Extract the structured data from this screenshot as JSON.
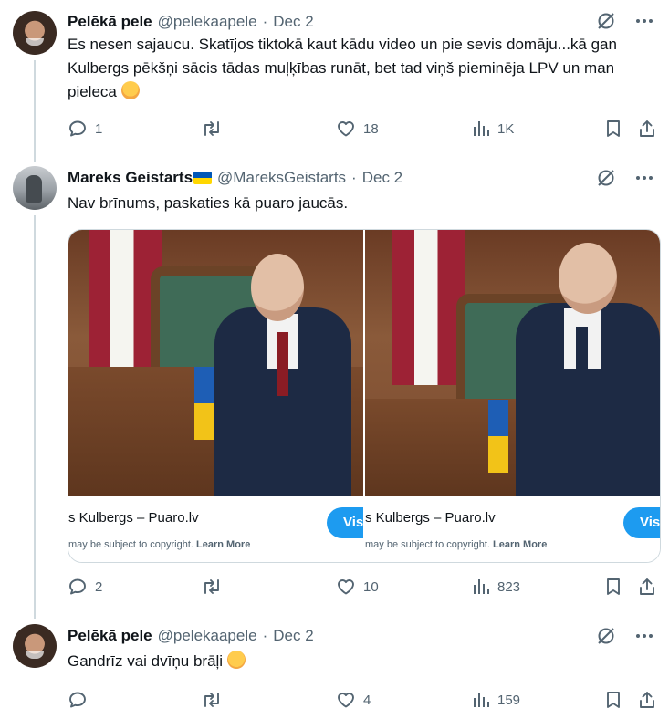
{
  "tweets": [
    {
      "name": "Pelēkā pele",
      "handle": "@pelekaapele",
      "sep": "·",
      "date": "Dec 2",
      "text": "Es nesen sajaucu. Skatījos tiktokā kaut kādu video un pie sevis domāju...kā gan Kulbergs pēkšņi sācis tādas muļķības runāt, bet tad viņš pieminēja LPV un man pieleca",
      "emoji": "face-palm-emoji",
      "stats": {
        "replies": "1",
        "reposts": "",
        "likes": "18",
        "views": "1K"
      }
    },
    {
      "name": "Mareks Geistarts",
      "flag": "ukraine-flag-emoji",
      "handle": "@MareksGeistarts",
      "sep": "·",
      "date": "Dec 2",
      "text": "Nav brīnums,  paskaties kā puaro jaucās.",
      "media": [
        {
          "title": "s Kulbergs – Puaro.lv",
          "note": "may be subject to copyright.",
          "learn_more": "Learn More",
          "visit": "Vis"
        },
        {
          "title": "s Kulbergs – Puaro.lv",
          "note": "may be subject to copyright.",
          "learn_more": "Learn More",
          "visit": "Vis"
        }
      ],
      "stats": {
        "replies": "2",
        "reposts": "",
        "likes": "10",
        "views": "823"
      }
    },
    {
      "name": "Pelēkā pele",
      "handle": "@pelekaapele",
      "sep": "·",
      "date": "Dec 2",
      "text": "Gandrīz vai dvīņu brāļi",
      "emoji": "laughing-tears-emoji",
      "stats": {
        "replies": "",
        "reposts": "",
        "likes": "4",
        "views": "159"
      }
    }
  ],
  "colors": {
    "text": "#0f1419",
    "secondary": "#536471",
    "accent": "#1d9bf0",
    "divider": "#cfd9de"
  }
}
